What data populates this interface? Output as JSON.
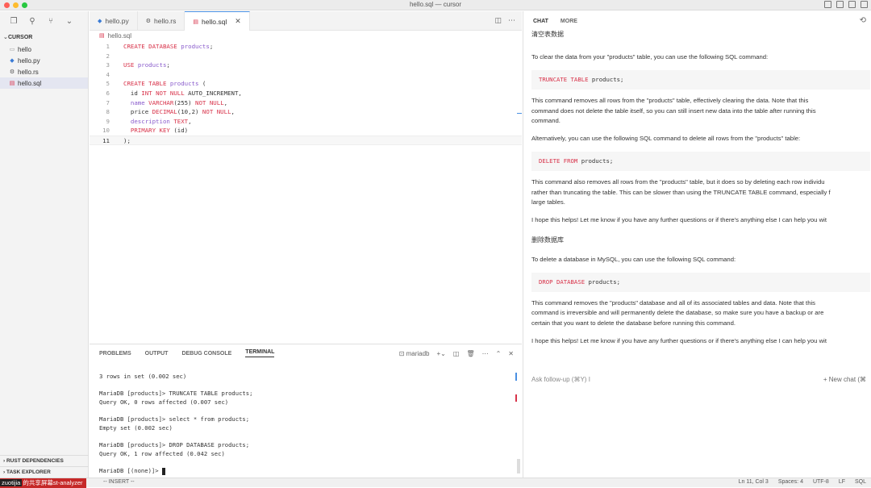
{
  "window": {
    "title": "hello.sql — cursor"
  },
  "sidebar": {
    "section": "CURSOR",
    "files": [
      {
        "name": "hello",
        "icon": "file-icon"
      },
      {
        "name": "hello.py",
        "icon": "python-file-icon"
      },
      {
        "name": "hello.rs",
        "icon": "rust-file-icon"
      },
      {
        "name": "hello.sql",
        "icon": "sql-file-icon"
      }
    ],
    "bottom_sections": [
      "RUST DEPENDENCIES",
      "TASK EXPLORER"
    ]
  },
  "editor": {
    "tabs": [
      {
        "label": "hello.py"
      },
      {
        "label": "hello.rs"
      },
      {
        "label": "hello.sql"
      }
    ],
    "breadcrumb": "hello.sql",
    "current_line": 11,
    "lines": [
      "CREATE DATABASE products;",
      "",
      "USE products;",
      "",
      "CREATE TABLE products (",
      "  id INT NOT NULL AUTO_INCREMENT,",
      "  name VARCHAR(255) NOT NULL,",
      "  price DECIMAL(10,2) NOT NULL,",
      "  description TEXT,",
      "  PRIMARY KEY (id)",
      ");"
    ]
  },
  "panel": {
    "tabs": [
      "PROBLEMS",
      "OUTPUT",
      "DEBUG CONSOLE",
      "TERMINAL"
    ],
    "active_tab": "TERMINAL",
    "terminal_name": "mariadb",
    "terminal_lines": [
      "3 rows in set (0.002 sec)",
      "",
      "MariaDB [products]> TRUNCATE TABLE products;",
      "Query OK, 0 rows affected (0.007 sec)",
      "",
      "MariaDB [products]> select * from products;",
      "Empty set (0.002 sec)",
      "",
      "MariaDB [products]> DROP DATABASE products;",
      "Query OK, 1 row affected (0.042 sec)",
      "",
      "MariaDB [(none)]> "
    ]
  },
  "chat": {
    "tabs": [
      "CHAT",
      "MORE"
    ],
    "user_msg_1": "清空表数据",
    "assistant_1": {
      "intro": "To clear the data from your \"products\" table, you can use the following SQL command:",
      "code1": "TRUNCATE TABLE products;",
      "p1_line1": "This command removes all rows from the \"products\" table, effectively clearing the data. Note that this",
      "p1_line2": "command does not delete the table itself, so you can still insert new data into the table after running this",
      "p1_line3": "command.",
      "alt": "Alternatively, you can use the following SQL command to delete all rows from the \"products\" table:",
      "code2": "DELETE FROM products;",
      "p2_line1": "This command also removes all rows from the \"products\" table, but it does so by deleting each row individu",
      "p2_line2": "rather than truncating the table. This can be slower than using the TRUNCATE TABLE command, especially f",
      "p2_line3": "large tables.",
      "outro": "I hope this helps! Let me know if you have any further questions or if there's anything else I can help you wit"
    },
    "user_msg_2": "删除数据库",
    "assistant_2": {
      "intro": "To delete a database in MySQL, you can use the following SQL command:",
      "code": "DROP DATABASE products;",
      "p_line1": "This command removes the \"products\" database and all of its associated tables and data. Note that this",
      "p_line2": "command is irreversible and will permanently delete the database, so make sure you have a backup or are",
      "p_line3": "certain that you want to delete the database before running this command.",
      "outro": "I hope this helps! Let me know if you have any further questions or if there's anything else I can help you wit"
    },
    "ask_placeholder": "Ask follow-up (⌘Y)",
    "new_chat": "+ New chat (⌘"
  },
  "statusbar": {
    "share_prefix": "zuotijia",
    "share_rest": "的共享屏幕st-analyzer",
    "mode": "-- INSERT --",
    "position": "Ln 11, Col 3",
    "spaces": "Spaces: 4",
    "encoding": "UTF-8",
    "eol": "LF",
    "language": "SQL"
  }
}
